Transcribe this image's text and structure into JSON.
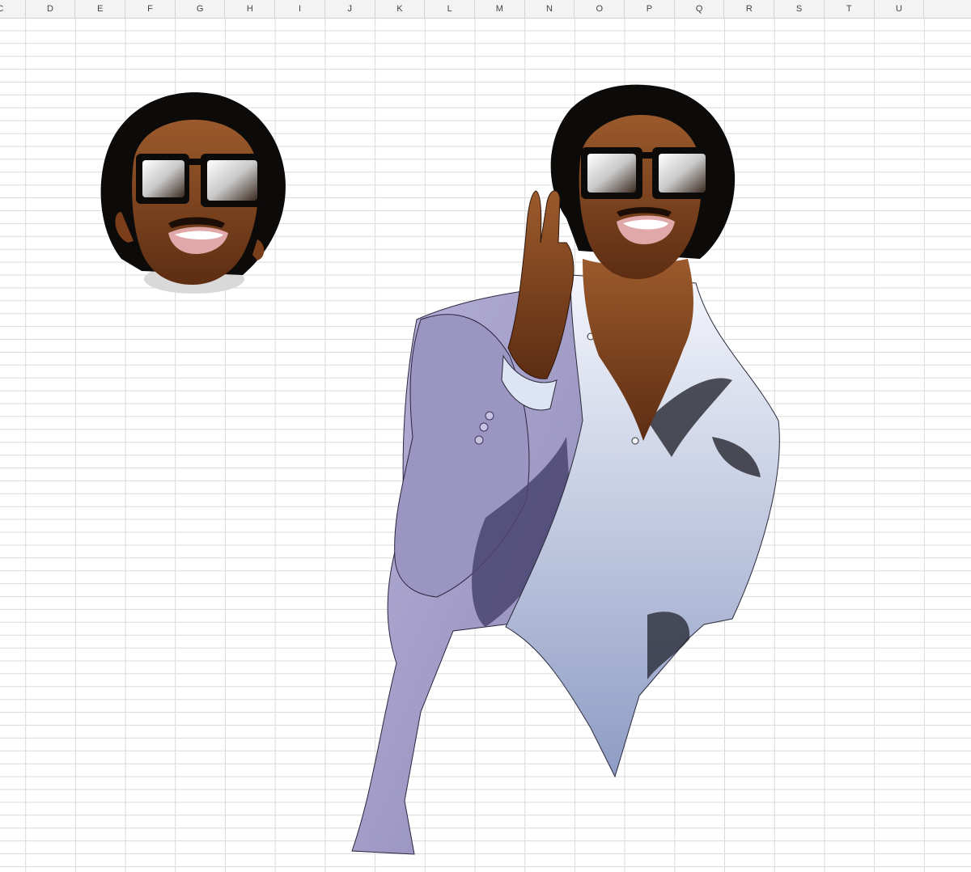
{
  "spreadsheet": {
    "columns": [
      "C",
      "D",
      "E",
      "F",
      "G",
      "H",
      "I",
      "J",
      "K",
      "L",
      "M",
      "N",
      "O",
      "P",
      "Q",
      "R",
      "S",
      "T",
      "U"
    ]
  },
  "artwork": {
    "small_head": "portrait-head-small",
    "full_figure": "portrait-figure-suit"
  },
  "colors": {
    "header_bg": "#f3f3f3",
    "grid_line": "#dadada",
    "skin": "#8a4a22",
    "skin_shadow": "#4a230d",
    "hair": "#0d0b0a",
    "jacket": "#a6a0c8",
    "jacket_shadow": "#6d6798",
    "shirt": "#e6ecf8",
    "shirt_shadow": "#9aa6c8"
  }
}
